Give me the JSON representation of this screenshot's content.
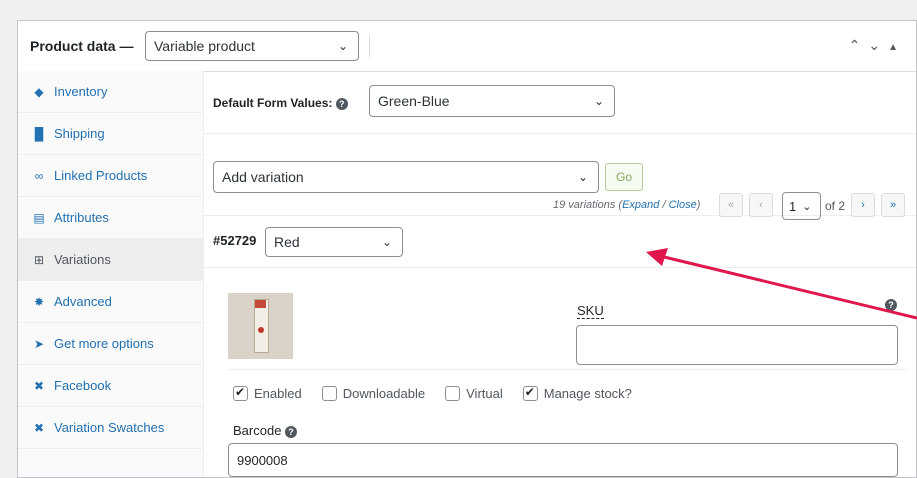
{
  "header": {
    "title": "Product data —",
    "product_type": "Variable product"
  },
  "sidebar": {
    "items": [
      {
        "label": "Inventory",
        "icon": "inventory-icon"
      },
      {
        "label": "Shipping",
        "icon": "truck-icon"
      },
      {
        "label": "Linked Products",
        "icon": "link-icon"
      },
      {
        "label": "Attributes",
        "icon": "list-icon"
      },
      {
        "label": "Variations",
        "icon": "grid-icon"
      },
      {
        "label": "Advanced",
        "icon": "gear-icon"
      },
      {
        "label": "Get more options",
        "icon": "plugin-icon"
      },
      {
        "label": "Facebook",
        "icon": "wrench-icon"
      },
      {
        "label": "Variation Swatches",
        "icon": "wrench-icon"
      }
    ],
    "active": "Variations"
  },
  "defaults": {
    "label": "Default Form Values:",
    "value": "Green-Blue"
  },
  "variation_actions": {
    "select_value": "Add variation",
    "go_label": "Go",
    "count_text": "19 variations (",
    "expand": "Expand",
    "slash": " / ",
    "close": "Close",
    "close_paren": ")",
    "first": "«",
    "prev": "‹",
    "next": "›",
    "last": "»",
    "page": "1",
    "of_text": "of 2"
  },
  "variation": {
    "id": "#52729",
    "attribute": "Red",
    "sku_label": "SKU",
    "checks": [
      {
        "label": "Enabled",
        "checked": true
      },
      {
        "label": "Downloadable",
        "checked": false
      },
      {
        "label": "Virtual",
        "checked": false
      },
      {
        "label": "Manage stock?",
        "checked": true
      }
    ],
    "barcode_label": "Barcode",
    "barcode_value": "9900008"
  },
  "colors": {
    "link": "#2271b1",
    "arrow": "#e0174a"
  }
}
